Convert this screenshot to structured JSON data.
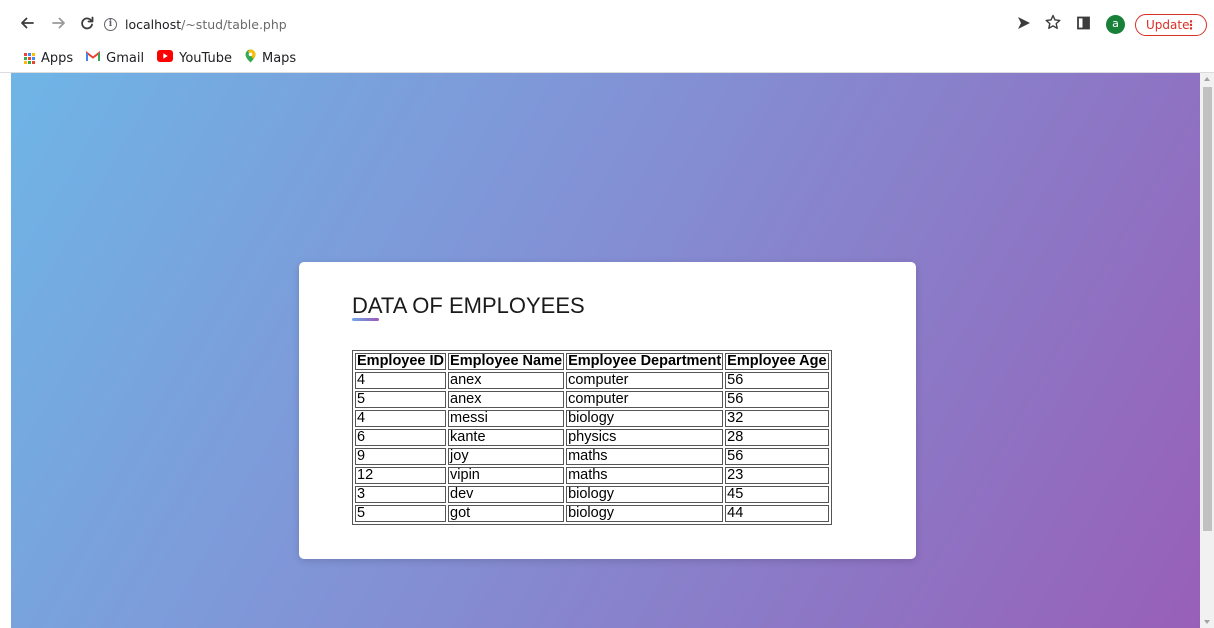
{
  "browser": {
    "url_host": "localhost",
    "url_path": "/~stud/table.php",
    "avatar_letter": "a",
    "update_label": "Update",
    "update_menu": "⋮",
    "bookmarks": [
      {
        "label": "Apps",
        "icon": "apps-grid-icon"
      },
      {
        "label": "Gmail",
        "icon": "gmail-icon"
      },
      {
        "label": "YouTube",
        "icon": "youtube-icon"
      },
      {
        "label": "Maps",
        "icon": "maps-pin-icon"
      }
    ]
  },
  "page": {
    "title": "DATA OF EMPLOYEES",
    "table": {
      "headers": [
        "Employee ID",
        "Employee Name",
        "Employee Department",
        "Employee Age"
      ],
      "rows": [
        [
          "4",
          "anex",
          "computer",
          "56"
        ],
        [
          "5",
          "anex",
          "computer",
          "56"
        ],
        [
          "4",
          "messi",
          "biology",
          "32"
        ],
        [
          "6",
          "kante",
          "physics",
          "28"
        ],
        [
          "9",
          "joy",
          "maths",
          "56"
        ],
        [
          "12",
          "vipin",
          "maths",
          "23"
        ],
        [
          "3",
          "dev",
          "biology",
          "45"
        ],
        [
          "5",
          "got",
          "biology",
          "44"
        ]
      ]
    }
  },
  "colors": {
    "gradient_start": "#6fb5e6",
    "gradient_end": "#985fb8",
    "update_accent": "#d93025",
    "avatar_bg": "#188038"
  }
}
